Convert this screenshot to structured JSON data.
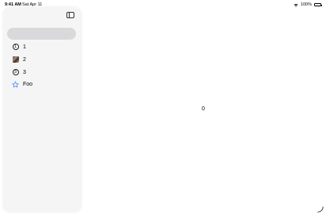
{
  "status_bar": {
    "time": "9:41 AM",
    "date": "Sat Apr 11",
    "battery": "100%"
  },
  "sidebar": {
    "items": [
      {
        "label": "1",
        "icon": "circle-1-icon"
      },
      {
        "label": "2",
        "icon": "photo-thumbnail-icon"
      },
      {
        "label": "3",
        "icon": "circle-3-icon"
      },
      {
        "label": "Foo",
        "icon": "star-icon"
      }
    ],
    "icon_glyphs": {
      "circle_1": "1",
      "circle_3": "3"
    }
  },
  "main": {
    "value": "0"
  },
  "colors": {
    "accent": "#2f7cf6",
    "sidebar_bg": "#f5f5f6",
    "search_bg": "#d9d9dc"
  }
}
